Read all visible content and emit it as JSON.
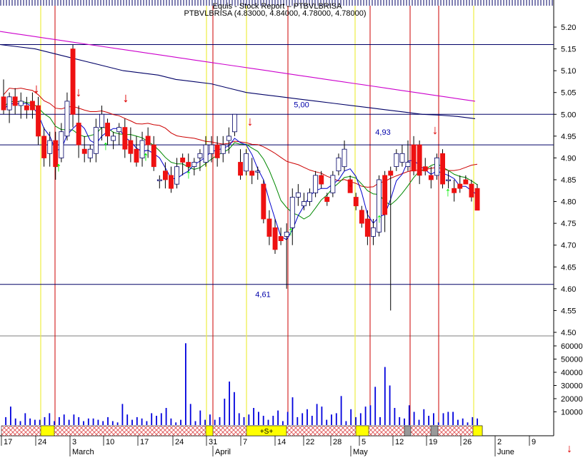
{
  "chart_data": {
    "type": "candlestick",
    "title": "Equis - Stock Report – PTBVLBRISA",
    "subtitle": "PTBVLBRISA (4,83000, 4,84000, 4,78000, 4,78000)",
    "ohlc_label_full": "PTBVLBRISA (4.83000, 4.84000, 4.78000, 4.78000)",
    "price_axis": {
      "ticks": [
        "5.20",
        "5.15",
        "5.10",
        "5.05",
        "5.00",
        "4.95",
        "4.90",
        "4.85",
        "4.80",
        "4.75",
        "4.70",
        "4.65",
        "4.60",
        "4.55",
        "4.50"
      ],
      "range": [
        4.48,
        5.22
      ]
    },
    "volume_axis": {
      "ticks": [
        "60000",
        "50000",
        "40000",
        "30000",
        "20000",
        "10000"
      ],
      "range": [
        0,
        70000
      ]
    },
    "x_axis": {
      "day_labels": [
        "17",
        "24",
        "3",
        "10",
        "17",
        "24",
        "31",
        "7",
        "14",
        "22",
        "28",
        "5",
        "12",
        "19",
        "26",
        "2",
        "9"
      ],
      "month_labels": [
        "March",
        "April",
        "May",
        "June"
      ]
    },
    "annotations": [
      {
        "text": "5,00",
        "price": 5.0
      },
      {
        "text": "4,93",
        "price": 4.93
      },
      {
        "text": "4,61",
        "price": 4.61
      }
    ],
    "horizontal_levels": [
      5.16,
      5.0,
      4.93,
      4.61
    ],
    "strip_label": "+S+",
    "candles": [
      {
        "o": 5.04,
        "h": 5.08,
        "l": 5.0,
        "c": 5.01
      },
      {
        "o": 5.01,
        "h": 5.05,
        "l": 4.98,
        "c": 5.04
      },
      {
        "o": 5.04,
        "h": 5.06,
        "l": 5.0,
        "c": 5.02
      },
      {
        "o": 5.02,
        "h": 5.05,
        "l": 4.99,
        "c": 5.03
      },
      {
        "o": 5.02,
        "h": 5.04,
        "l": 4.99,
        "c": 5.01
      },
      {
        "o": 5.03,
        "h": 5.05,
        "l": 4.99,
        "c": 5.01
      },
      {
        "o": 5.02,
        "h": 5.04,
        "l": 4.93,
        "c": 4.95
      },
      {
        "o": 4.95,
        "h": 4.97,
        "l": 4.88,
        "c": 4.9
      },
      {
        "o": 4.91,
        "h": 4.96,
        "l": 4.88,
        "c": 4.94
      },
      {
        "o": 4.94,
        "h": 4.96,
        "l": 4.85,
        "c": 4.88
      },
      {
        "o": 4.9,
        "h": 4.98,
        "l": 4.89,
        "c": 4.96
      },
      {
        "o": 4.95,
        "h": 5.05,
        "l": 4.94,
        "c": 5.03
      },
      {
        "o": 5.15,
        "h": 5.16,
        "l": 4.97,
        "c": 5.0
      },
      {
        "o": 4.98,
        "h": 5.02,
        "l": 4.9,
        "c": 4.93
      },
      {
        "o": 4.92,
        "h": 4.95,
        "l": 4.89,
        "c": 4.91
      },
      {
        "o": 4.9,
        "h": 4.93,
        "l": 4.89,
        "c": 4.92
      },
      {
        "o": 4.91,
        "h": 4.99,
        "l": 4.89,
        "c": 4.97
      },
      {
        "o": 4.97,
        "h": 5.02,
        "l": 4.94,
        "c": 5.0
      },
      {
        "o": 4.98,
        "h": 4.99,
        "l": 4.93,
        "c": 4.95
      },
      {
        "o": 4.94,
        "h": 4.96,
        "l": 4.92,
        "c": 4.95
      },
      {
        "o": 4.96,
        "h": 4.98,
        "l": 4.93,
        "c": 4.97
      },
      {
        "o": 4.97,
        "h": 4.99,
        "l": 4.9,
        "c": 4.92
      },
      {
        "o": 4.94,
        "h": 4.97,
        "l": 4.89,
        "c": 4.91
      },
      {
        "o": 4.92,
        "h": 4.95,
        "l": 4.88,
        "c": 4.89
      },
      {
        "o": 4.9,
        "h": 4.96,
        "l": 4.88,
        "c": 4.94
      },
      {
        "o": 4.95,
        "h": 4.97,
        "l": 4.9,
        "c": 4.93
      },
      {
        "o": 4.93,
        "h": 4.95,
        "l": 4.87,
        "c": 4.88
      },
      {
        "o": 4.85,
        "h": 4.86,
        "l": 4.83,
        "c": 4.85
      },
      {
        "o": 4.87,
        "h": 4.89,
        "l": 4.83,
        "c": 4.85
      },
      {
        "o": 4.86,
        "h": 4.88,
        "l": 4.82,
        "c": 4.83
      },
      {
        "o": 4.84,
        "h": 4.9,
        "l": 4.83,
        "c": 4.88
      },
      {
        "o": 4.9,
        "h": 4.91,
        "l": 4.86,
        "c": 4.89
      },
      {
        "o": 4.89,
        "h": 4.91,
        "l": 4.87,
        "c": 4.88
      },
      {
        "o": 4.88,
        "h": 4.9,
        "l": 4.86,
        "c": 4.89
      },
      {
        "o": 4.9,
        "h": 4.92,
        "l": 4.87,
        "c": 4.91
      },
      {
        "o": 4.89,
        "h": 4.95,
        "l": 4.88,
        "c": 4.93
      },
      {
        "o": 4.91,
        "h": 4.95,
        "l": 4.89,
        "c": 4.93
      },
      {
        "o": 4.93,
        "h": 4.95,
        "l": 4.88,
        "c": 4.9
      },
      {
        "o": 4.91,
        "h": 4.95,
        "l": 4.89,
        "c": 4.93
      },
      {
        "o": 4.94,
        "h": 4.97,
        "l": 4.91,
        "c": 4.95
      },
      {
        "o": 4.96,
        "h": 5.0,
        "l": 4.95,
        "c": 5.0
      },
      {
        "o": 4.89,
        "h": 4.92,
        "l": 4.85,
        "c": 4.86
      },
      {
        "o": 4.87,
        "h": 4.92,
        "l": 4.86,
        "c": 4.91
      },
      {
        "o": 4.87,
        "h": 4.9,
        "l": 4.84,
        "c": 4.86
      },
      {
        "o": 4.87,
        "h": 4.88,
        "l": 4.85,
        "c": 4.87
      },
      {
        "o": 4.84,
        "h": 4.85,
        "l": 4.75,
        "c": 4.76
      },
      {
        "o": 4.76,
        "h": 4.78,
        "l": 4.7,
        "c": 4.72
      },
      {
        "o": 4.74,
        "h": 4.76,
        "l": 4.68,
        "c": 4.69
      },
      {
        "o": 4.72,
        "h": 4.74,
        "l": 4.7,
        "c": 4.71
      },
      {
        "o": 4.72,
        "h": 4.75,
        "l": 4.6,
        "c": 4.73
      },
      {
        "o": 4.74,
        "h": 4.83,
        "l": 4.7,
        "c": 4.81
      },
      {
        "o": 4.81,
        "h": 4.84,
        "l": 4.79,
        "c": 4.82
      },
      {
        "o": 4.79,
        "h": 4.82,
        "l": 4.78,
        "c": 4.8
      },
      {
        "o": 4.8,
        "h": 4.83,
        "l": 4.79,
        "c": 4.82
      },
      {
        "o": 4.82,
        "h": 4.87,
        "l": 4.81,
        "c": 4.86
      },
      {
        "o": 4.86,
        "h": 4.87,
        "l": 4.83,
        "c": 4.84
      },
      {
        "o": 4.81,
        "h": 4.82,
        "l": 4.79,
        "c": 4.8
      },
      {
        "o": 4.82,
        "h": 4.87,
        "l": 4.81,
        "c": 4.86
      },
      {
        "o": 4.87,
        "h": 4.91,
        "l": 4.86,
        "c": 4.9
      },
      {
        "o": 4.88,
        "h": 4.94,
        "l": 4.87,
        "c": 4.92
      },
      {
        "o": 4.85,
        "h": 4.86,
        "l": 4.82,
        "c": 4.82
      },
      {
        "o": 4.81,
        "h": 4.82,
        "l": 4.78,
        "c": 4.79
      },
      {
        "o": 4.78,
        "h": 4.79,
        "l": 4.74,
        "c": 4.75
      },
      {
        "o": 4.76,
        "h": 4.78,
        "l": 4.7,
        "c": 4.72
      },
      {
        "o": 4.72,
        "h": 4.76,
        "l": 4.7,
        "c": 4.74
      },
      {
        "o": 4.73,
        "h": 4.86,
        "l": 4.72,
        "c": 4.85
      },
      {
        "o": 4.86,
        "h": 4.87,
        "l": 4.73,
        "c": 4.77
      },
      {
        "o": 4.87,
        "h": 4.88,
        "l": 4.55,
        "c": 4.86
      },
      {
        "o": 4.88,
        "h": 4.92,
        "l": 4.87,
        "c": 4.91
      },
      {
        "o": 4.89,
        "h": 4.93,
        "l": 4.88,
        "c": 4.91
      },
      {
        "o": 4.88,
        "h": 4.94,
        "l": 4.87,
        "c": 4.89
      },
      {
        "o": 4.93,
        "h": 4.95,
        "l": 4.86,
        "c": 4.87
      },
      {
        "o": 4.93,
        "h": 4.94,
        "l": 4.84,
        "c": 4.86
      },
      {
        "o": 4.88,
        "h": 4.9,
        "l": 4.86,
        "c": 4.87
      },
      {
        "o": 4.86,
        "h": 4.88,
        "l": 4.83,
        "c": 4.85
      },
      {
        "o": 4.86,
        "h": 4.91,
        "l": 4.85,
        "c": 4.9
      },
      {
        "o": 4.91,
        "h": 4.92,
        "l": 4.83,
        "c": 4.84
      },
      {
        "o": 4.85,
        "h": 4.87,
        "l": 4.83,
        "c": 4.85
      },
      {
        "o": 4.83,
        "h": 4.85,
        "l": 4.8,
        "c": 4.82
      },
      {
        "o": 4.84,
        "h": 4.86,
        "l": 4.82,
        "c": 4.83
      },
      {
        "o": 4.85,
        "h": 4.86,
        "l": 4.84,
        "c": 4.84
      },
      {
        "o": 4.84,
        "h": 4.85,
        "l": 4.8,
        "c": 4.81
      },
      {
        "o": 4.83,
        "h": 4.84,
        "l": 4.78,
        "c": 4.78
      }
    ],
    "volume": [
      6000,
      14000,
      5000,
      3000,
      9000,
      5000,
      4000,
      4000,
      6000,
      9000,
      3000,
      6000,
      8000,
      4000,
      8000,
      6000,
      3000,
      5000,
      5000,
      4000,
      3000,
      6000,
      3000,
      2000,
      16000,
      8000,
      4000,
      6000,
      5000,
      3000,
      9000,
      7000,
      9000,
      13000,
      5000,
      2000,
      4000,
      62000,
      16000,
      3000,
      11000,
      4000,
      8000,
      4000,
      6000,
      20000,
      33000,
      25000,
      9000,
      6000,
      8000,
      13000,
      10000,
      7000,
      4000,
      7000,
      11000,
      3000,
      10000,
      21000,
      6000,
      9000,
      12000,
      7000,
      16000,
      14000,
      4000,
      8000,
      9000,
      22000,
      3000,
      12000,
      6000,
      9000,
      14000,
      15000,
      29000,
      6000,
      44000,
      30000,
      13000,
      6000,
      5000,
      15000,
      10000,
      4000,
      12000,
      7000,
      9000,
      2000,
      9000,
      10000,
      10000,
      4000,
      5000,
      2000,
      6000,
      5000
    ],
    "ma_magenta": [
      5.19,
      5.185,
      5.18,
      5.175,
      5.17,
      5.165,
      5.16,
      5.155,
      5.15,
      5.145,
      5.14,
      5.135,
      5.13,
      5.125,
      5.12,
      5.115,
      5.11,
      5.105,
      5.1,
      5.095,
      5.09,
      5.085,
      5.08,
      5.075,
      5.07,
      5.065,
      5.06,
      5.055,
      5.05,
      5.045,
      5.04,
      5.035,
      5.03
    ],
    "ma_navy": [
      5.16,
      5.155,
      5.15,
      5.14,
      5.13,
      5.12,
      5.11,
      5.1,
      5.095,
      5.09,
      5.08,
      5.075,
      5.07,
      5.06,
      5.05,
      5.045,
      5.04,
      5.035,
      5.03,
      5.025,
      5.02,
      5.015,
      5.01,
      5.005,
      5.0,
      4.998,
      4.995,
      4.99
    ],
    "signals_down": [
      "↓",
      "↓",
      "↓",
      "↓",
      "↓",
      "↓",
      "↓",
      "↓"
    ],
    "signals_up": [
      "↑",
      "↑",
      "↑",
      "↑",
      "↑",
      "↑",
      "↑",
      "↑",
      "↑"
    ],
    "colors": {
      "bear": "#ee1111",
      "bull": "#ffffff",
      "wick": "#000000",
      "ma_red": "#cc0000",
      "ma_green": "#008800",
      "ma_blue": "#0000cc",
      "ma_magenta": "#cc00cc",
      "ma_navy": "#000066",
      "signal_down": "#dd0000",
      "signal_up": "#00ee00",
      "volume": "#0000dd",
      "grid_red": "#cc0000",
      "grid_yellow": "#eeee44",
      "hline": "#000066",
      "annotation": "#0000aa",
      "strip_yellow": "#ffff00",
      "strip_grey": "#999999",
      "hatch": "#e05050"
    }
  },
  "ui": {
    "corner_arrow": "↓"
  }
}
